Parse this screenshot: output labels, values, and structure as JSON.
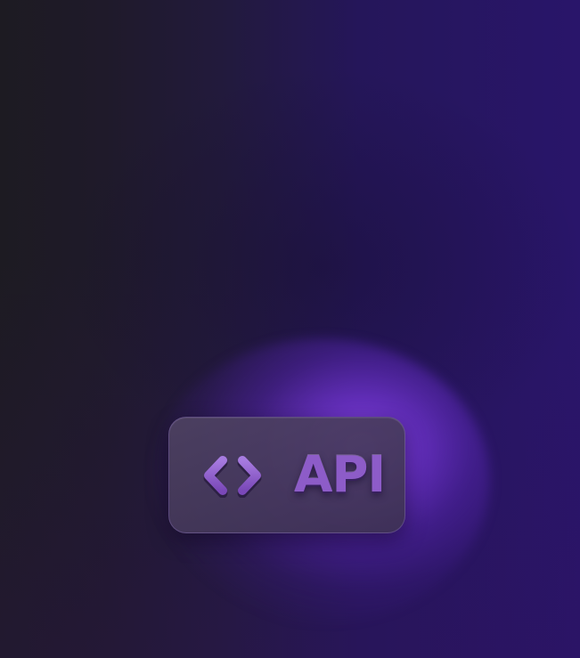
{
  "badge": {
    "icon": "code-brackets-icon",
    "label": "API"
  },
  "colors": {
    "background_left": "#1d1b22",
    "background_right": "#29156a",
    "glow": "#8c46f0",
    "badge_fill": "#4e4262",
    "accent_text": "#8d5cc8"
  }
}
